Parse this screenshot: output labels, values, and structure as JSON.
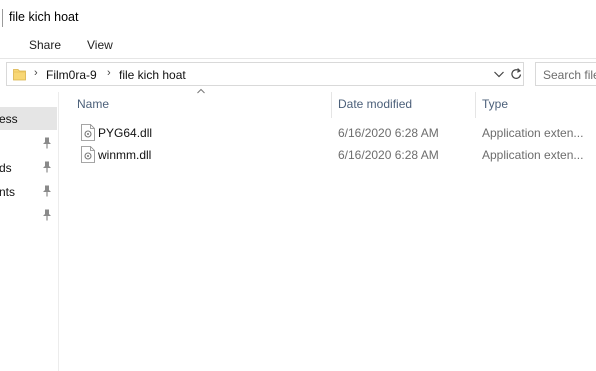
{
  "window": {
    "title": "file kich hoat"
  },
  "ribbon": {
    "tabs": [
      {
        "label": "Share"
      },
      {
        "label": "View"
      }
    ]
  },
  "address": {
    "breadcrumbs": [
      {
        "label": "Film0ra-9"
      },
      {
        "label": "file kich hoat"
      }
    ]
  },
  "search": {
    "placeholder": "Search file"
  },
  "navpane": {
    "items": [
      {
        "label": "ess",
        "pinned": false,
        "state": "selected"
      },
      {
        "label": "",
        "pinned": true
      },
      {
        "label": "ds",
        "pinned": true
      },
      {
        "label": "nts",
        "pinned": true
      },
      {
        "label": "",
        "pinned": true
      }
    ]
  },
  "columns": {
    "name": "Name",
    "date": "Date modified",
    "type": "Type",
    "sort": "name-ascending"
  },
  "files": [
    {
      "name": "PYG64.dll",
      "date": "6/16/2020 6:28 AM",
      "type": "Application exten..."
    },
    {
      "name": "winmm.dll",
      "date": "6/16/2020 6:28 AM",
      "type": "Application exten..."
    }
  ],
  "colors": {
    "selection": "#cce8ff",
    "header_text": "#4c607a",
    "folder": "#f8d775",
    "secondary_text": "#6d6d6d"
  },
  "icons": {
    "folder": "folder-icon",
    "file": "dll-file-icon",
    "pin": "pin-icon",
    "refresh": "refresh-icon",
    "dropdown": "chevron-down-icon",
    "sort": "sort-up-icon"
  }
}
